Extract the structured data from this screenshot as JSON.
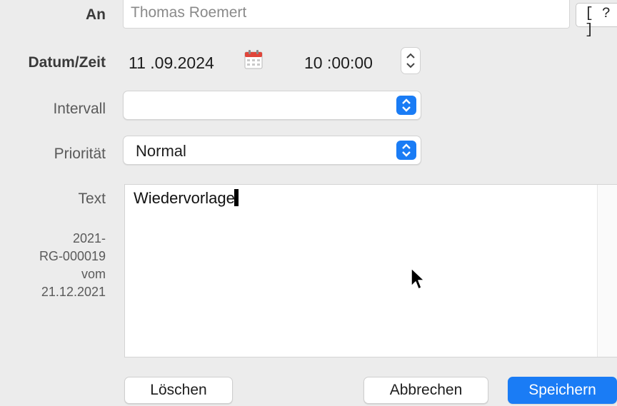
{
  "form": {
    "an_label": "An",
    "an_value": "Thomas Roemert",
    "help_button": "[ ? ]",
    "datetime_label": "Datum/Zeit",
    "date_value": "11 .09.2024",
    "time_value": "10 :00:00",
    "interval_label": "Intervall",
    "interval_value": "",
    "priority_label": "Priorität",
    "priority_value": "Normal",
    "text_label": "Text",
    "text_value": "Wiedervorlage",
    "reference_lines": [
      "2021-",
      "RG-000019",
      "vom",
      "21.12.2021"
    ]
  },
  "buttons": {
    "delete": "Löschen",
    "cancel": "Abbrechen",
    "save": "Speichern"
  },
  "icons": {
    "calendar": "calendar-icon",
    "stepper": "time-stepper-icon",
    "popup_arrows": "chevron-updown-icon",
    "cursor": "mouse-pointer-icon"
  },
  "colors": {
    "accent": "#1a7cf5",
    "background": "#ececec",
    "calendar_red": "#e0453a"
  }
}
